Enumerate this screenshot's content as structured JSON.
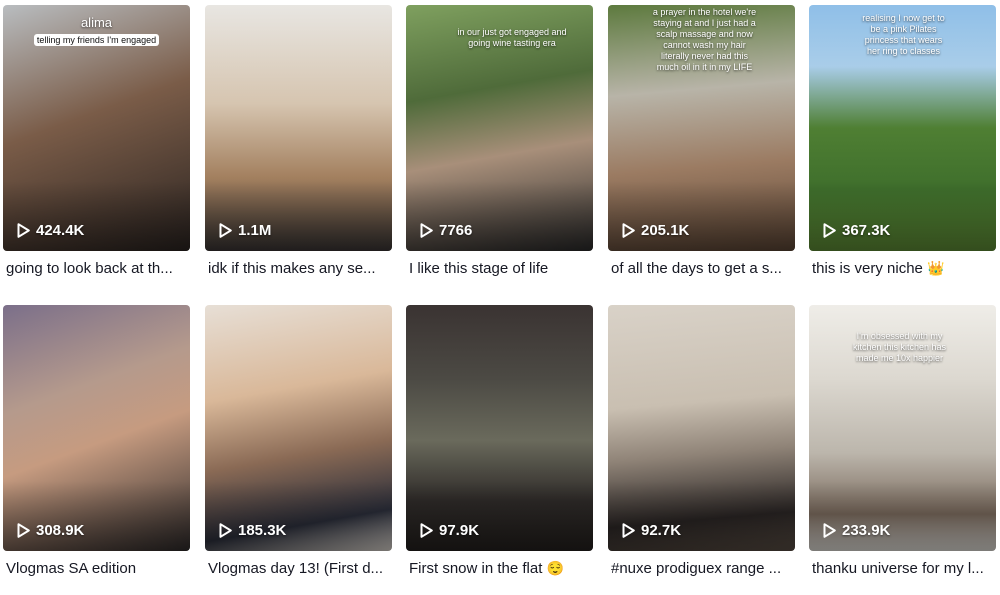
{
  "colors": {
    "text": "#161823",
    "overlay_text": "#ffffff",
    "background": "#ffffff"
  },
  "icons": {
    "play": "play-icon"
  },
  "videos": [
    {
      "views": "424.4K",
      "caption": "going to look back at th...",
      "overlay_lines": [
        "alima",
        "telling my friends I'm engaged"
      ],
      "thumb_colors": [
        "#b9bdc0",
        "#6a4e3c",
        "#2a2320"
      ]
    },
    {
      "views": "1.1M",
      "caption": "idk if this makes any se...",
      "overlay_lines": [],
      "thumb_colors": [
        "#e8e6e2",
        "#c2a27c",
        "#4a3a30"
      ]
    },
    {
      "views": "7766",
      "caption": "I like this stage of life",
      "overlay_lines": [
        "in our just got engaged and going wine tasting era"
      ],
      "thumb_colors": [
        "#6f8f53",
        "#3a4a2e",
        "#2a2a2a"
      ]
    },
    {
      "views": "205.1K",
      "caption": "of all the days to get a s...",
      "overlay_lines": [
        "a prayer in the hotel we're staying at and I just had a scalp massage and now cannot wash my hair literally never had this much oil in it in my LIFE"
      ],
      "thumb_colors": [
        "#5d7a3e",
        "#c7c0b4",
        "#5a4434"
      ]
    },
    {
      "views": "367.3K",
      "caption": "this is very niche",
      "caption_emoji": "👑",
      "overlay_lines": [
        "realising I now get to be a pink Pilates princess that wears her ring to classes"
      ],
      "thumb_colors": [
        "#8fbfe8",
        "#3f6f2c",
        "#4d7a2f"
      ]
    },
    {
      "views": "308.9K",
      "caption": "Vlogmas SA edition",
      "overlay_lines": [],
      "thumb_colors": [
        "#7b6f8a",
        "#c69b80",
        "#2e2a2a"
      ]
    },
    {
      "views": "185.3K",
      "caption": "Vlogmas day 13! (First d...",
      "overlay_lines": [],
      "thumb_colors": [
        "#e7dfd6",
        "#caa27e",
        "#2b2e3a"
      ]
    },
    {
      "views": "97.9K",
      "caption": "First snow in the flat",
      "caption_emoji": "😌",
      "overlay_lines": [],
      "thumb_colors": [
        "#3a3332",
        "#5b5a52",
        "#24201e"
      ]
    },
    {
      "views": "92.7K",
      "caption": "#nuxe prodiguex range ...",
      "overlay_lines": [],
      "thumb_colors": [
        "#d9d2c8",
        "#b7ab9b",
        "#2a2524"
      ]
    },
    {
      "views": "233.9K",
      "caption": "thanku universe for my l...",
      "overlay_lines": [
        "I'm obsessed with my kitchen this kitchen has made me 10x happier"
      ],
      "thumb_colors": [
        "#efede8",
        "#c9c4bb",
        "#7a6a5d"
      ]
    }
  ]
}
